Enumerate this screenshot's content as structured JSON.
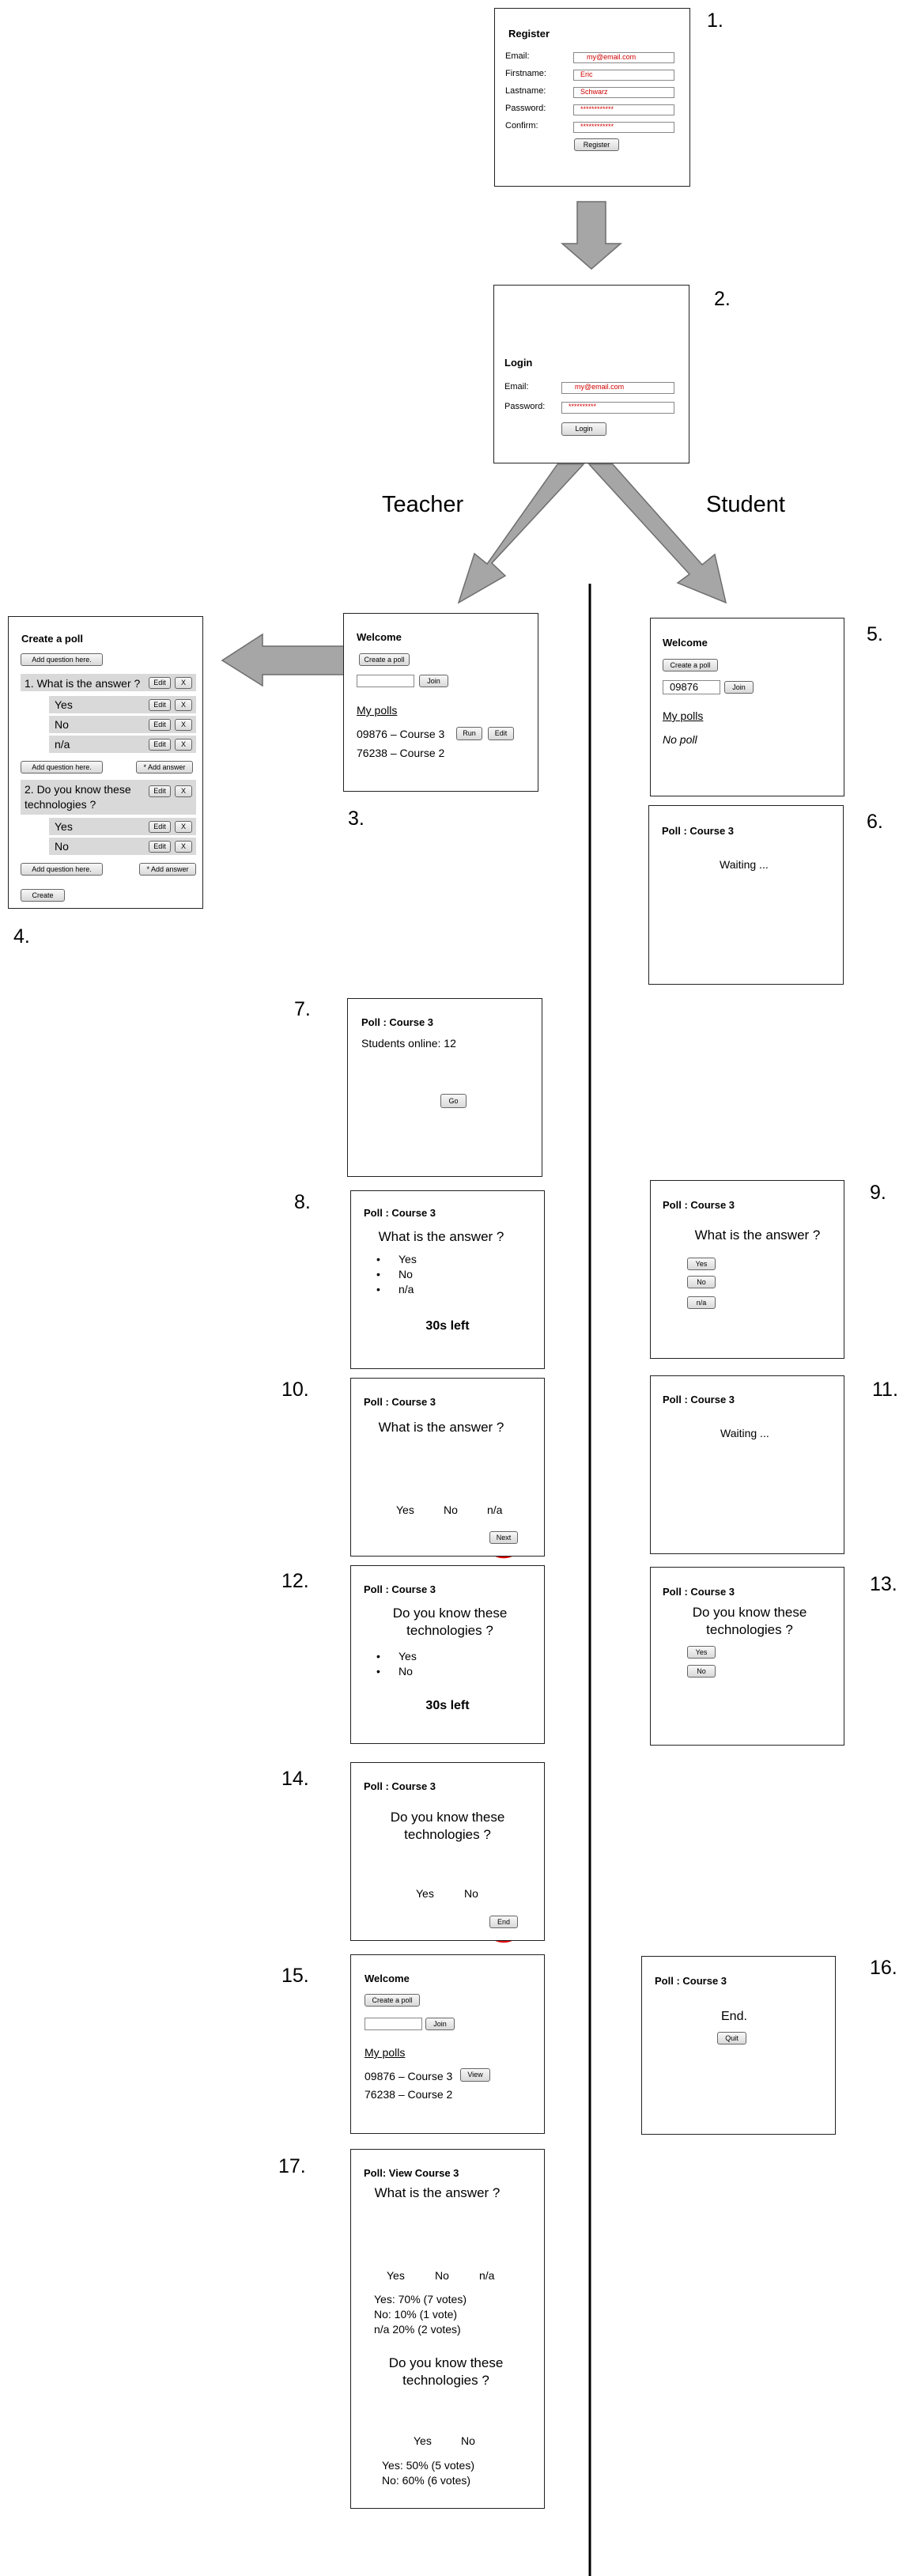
{
  "step_numbers": [
    "1.",
    "2.",
    "3.",
    "4.",
    "5.",
    "6.",
    "7.",
    "8.",
    "9.",
    "10.",
    "11.",
    "12.",
    "13.",
    "14.",
    "15.",
    "16.",
    "17."
  ],
  "flow_labels": {
    "teacher": "Teacher",
    "student": "Student"
  },
  "register": {
    "title": "Register",
    "labels": [
      "Email:",
      "Firstname:",
      "Lastname:",
      "Password:",
      "Confirm:"
    ],
    "values": [
      "my@email.com",
      "Eric",
      "Schwarz",
      "************",
      "************"
    ],
    "button": "Register"
  },
  "login": {
    "title": "Login",
    "labels": [
      "Email:",
      "Password:"
    ],
    "values": [
      "my@email.com",
      "**********"
    ],
    "button": "Login"
  },
  "teacher_welcome": {
    "title": "Welcome",
    "create_button": "Create a poll",
    "join_button": "Join",
    "my_polls": "My polls",
    "poll1": "09876 – Course 3",
    "poll2": "76238 – Course 2",
    "run_button": "Run",
    "edit_button": "Edit"
  },
  "create_poll": {
    "title": "Create a poll",
    "add_question": "Add question here.",
    "q1": "1. What is the answer ?",
    "q1_answers": [
      "Yes",
      "No",
      "n/a"
    ],
    "q2": "2. Do you know these technologies ?",
    "q2_answers": [
      "Yes",
      "No"
    ],
    "edit": "Edit",
    "x": "X",
    "add_answer": "* Add answer",
    "create": "Create"
  },
  "student_welcome": {
    "title": "Welcome",
    "create_button": "Create a poll",
    "code": "09876",
    "join_button": "Join",
    "my_polls": "My polls",
    "no_poll": "No poll"
  },
  "poll_title": "Poll : Course 3",
  "waiting": "Waiting ...",
  "students_online": "Students online: 12",
  "go_button": "Go",
  "q1": "What is the answer ?",
  "q2": "Do you know these technologies ?",
  "answers1": [
    "Yes",
    "No",
    "n/a"
  ],
  "answers2": [
    "Yes",
    "No"
  ],
  "time_left": "30s left",
  "next_button": "Next",
  "end_button": "End",
  "end_text": "End.",
  "quit_button": "Quit",
  "view_button": "View",
  "view": {
    "title": "Poll: View Course 3",
    "q1_stats": [
      "Yes: 70% (7 votes)",
      "No: 10% (1 vote)",
      "n/a 20% (2 votes)"
    ],
    "q2_stats": [
      "Yes: 50% (5 votes)",
      "No: 60% (6 votes)"
    ]
  },
  "colors": {
    "yes": "#00b050",
    "no": "#e46c0a",
    "na": "#8064a2",
    "highlight": "#e00000",
    "arrow": "#a6a6a6"
  }
}
